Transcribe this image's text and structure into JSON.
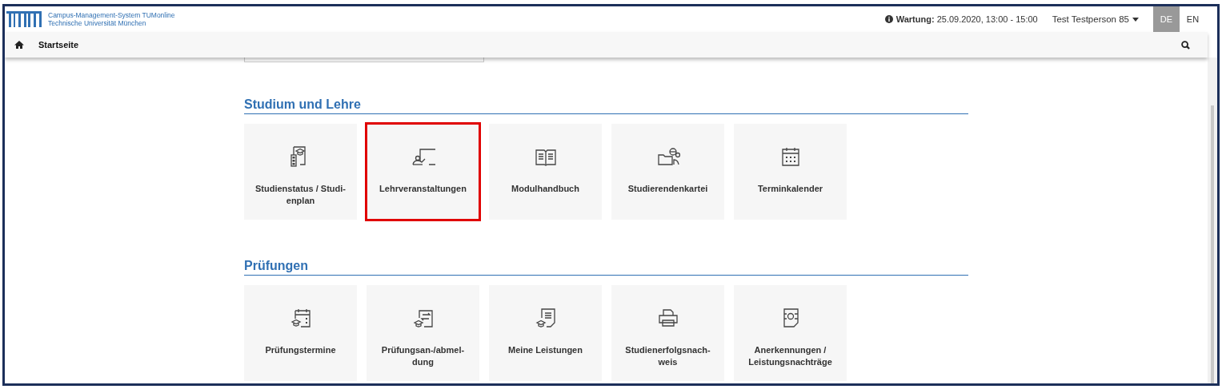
{
  "header": {
    "system_name": "Campus-Management-System TUMonline",
    "university": "Technische Universität München",
    "maintenance_label": "Wartung:",
    "maintenance_time": "25.09.2020, 13:00 - 15:00",
    "user": "Test Testperson 85",
    "languages": [
      {
        "label": "DE",
        "selected": true
      },
      {
        "label": "EN",
        "selected": false
      }
    ]
  },
  "nav": {
    "title": "Startseite"
  },
  "sections": [
    {
      "title": "Studium und Lehre",
      "tiles": [
        {
          "label": "Studienstatus / Studi-\nenplan",
          "highlighted": false
        },
        {
          "label": "Lehrveranstaltungen",
          "highlighted": true
        },
        {
          "label": "Modulhandbuch",
          "highlighted": false
        },
        {
          "label": "Studierendenkartei",
          "highlighted": false
        },
        {
          "label": "Terminkalender",
          "highlighted": false
        }
      ]
    },
    {
      "title": "Prüfungen",
      "tiles": [
        {
          "label": "Prüfungstermine",
          "highlighted": false
        },
        {
          "label": "Prüfungsan-/abmel-\ndung",
          "highlighted": false
        },
        {
          "label": "Meine Leistungen",
          "highlighted": false
        },
        {
          "label": "Studienerfolgsnach-\nweis",
          "highlighted": false
        },
        {
          "label": "Anerkennungen /\nLeistungsnachträge",
          "highlighted": false
        }
      ]
    }
  ]
}
